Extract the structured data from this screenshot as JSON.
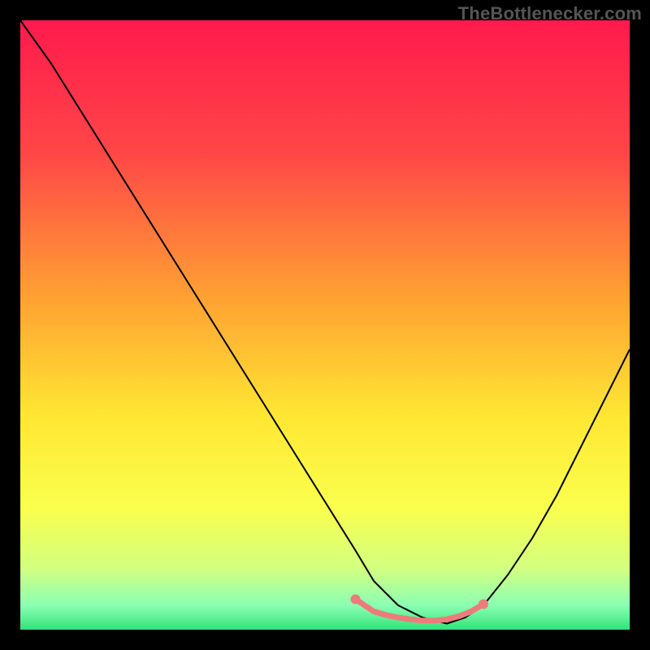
{
  "watermark": "TheBottlenecker.com",
  "chart_data": {
    "type": "line",
    "title": "",
    "xlabel": "",
    "ylabel": "",
    "xlim": [
      0,
      100
    ],
    "ylim": [
      0,
      100
    ],
    "grid": false,
    "background_gradient": {
      "stops": [
        {
          "offset": 0,
          "color": "#ff1a4d"
        },
        {
          "offset": 22,
          "color": "#ff4747"
        },
        {
          "offset": 45,
          "color": "#ff9f33"
        },
        {
          "offset": 65,
          "color": "#ffe733"
        },
        {
          "offset": 80,
          "color": "#faff4d"
        },
        {
          "offset": 90,
          "color": "#d2ff80"
        },
        {
          "offset": 96,
          "color": "#8bffb3"
        },
        {
          "offset": 100,
          "color": "#33e27a"
        }
      ]
    },
    "series": [
      {
        "name": "bottleneck-curve",
        "color": "#000000",
        "width": 2,
        "x": [
          0,
          5,
          10,
          15,
          20,
          25,
          30,
          35,
          40,
          45,
          50,
          55,
          58,
          62,
          66,
          70,
          73,
          76,
          80,
          84,
          88,
          92,
          96,
          100
        ],
        "y": [
          100,
          93,
          85,
          77,
          69,
          61,
          53,
          45,
          37,
          29,
          21,
          13,
          8,
          4,
          2,
          1,
          2,
          4,
          9,
          15,
          22,
          30,
          38,
          46
        ]
      }
    ],
    "highlight": {
      "name": "optimal-zone",
      "color": "#ed7b7b",
      "dot_radius": 5,
      "stroke_width": 7,
      "x": [
        55,
        58,
        60,
        62,
        64,
        66,
        68,
        70,
        72,
        74,
        76
      ],
      "y": [
        5,
        3,
        2.4,
        2.0,
        1.7,
        1.5,
        1.5,
        1.7,
        2.2,
        3.0,
        4.2
      ]
    }
  }
}
